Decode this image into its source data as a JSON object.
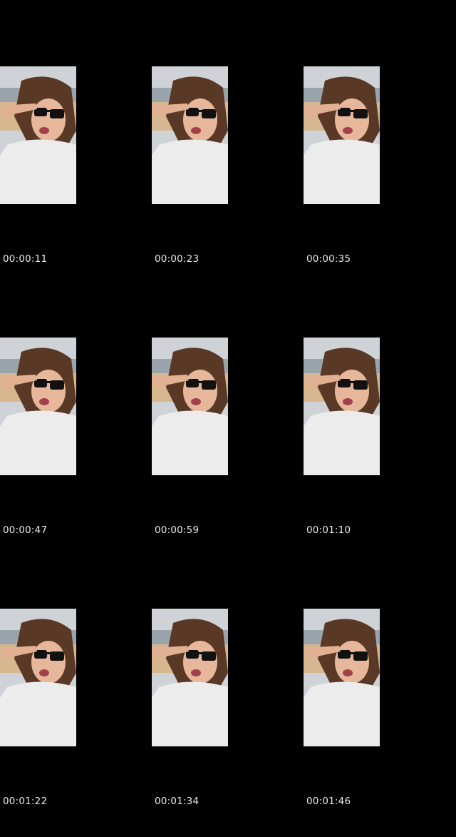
{
  "thumbnails": [
    {
      "timestamp": "00:00:11"
    },
    {
      "timestamp": "00:00:23"
    },
    {
      "timestamp": "00:00:35"
    },
    {
      "timestamp": "00:00:47"
    },
    {
      "timestamp": "00:00:59"
    },
    {
      "timestamp": "00:01:10"
    },
    {
      "timestamp": "00:01:22"
    },
    {
      "timestamp": "00:01:34"
    },
    {
      "timestamp": "00:01:46"
    }
  ],
  "colors": {
    "background": "#000000",
    "timestamp_text": "#e8e8e8"
  }
}
